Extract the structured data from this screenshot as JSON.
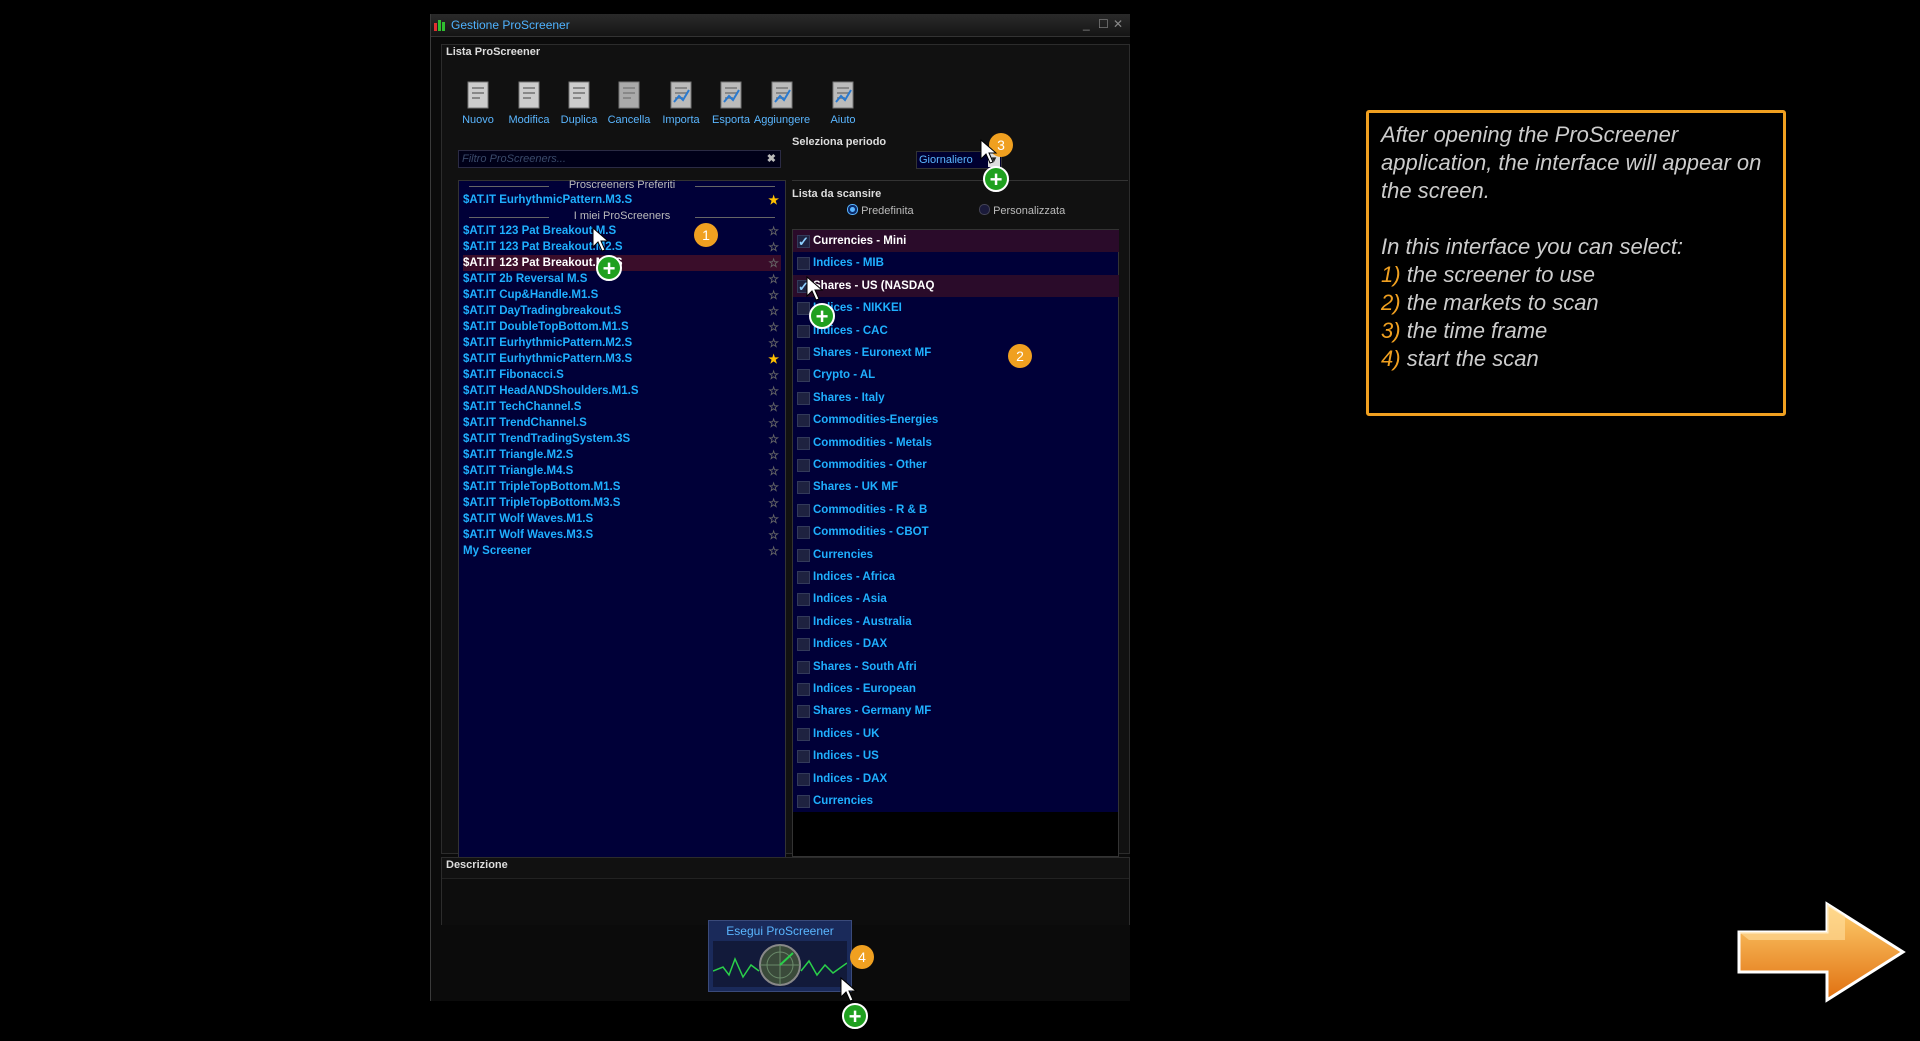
{
  "window": {
    "title": "Gestione ProScreener",
    "group_label": "Lista ProScreener"
  },
  "toolbar": [
    {
      "label": "Nuovo",
      "icon": "new-document-icon"
    },
    {
      "label": "Modifica",
      "icon": "edit-icon"
    },
    {
      "label": "Duplica",
      "icon": "duplicate-icon"
    },
    {
      "label": "Cancella",
      "icon": "trash-icon"
    },
    {
      "label": "Importa",
      "icon": "import-icon"
    },
    {
      "label": "Esporta",
      "icon": "export-icon"
    },
    {
      "label": "Aggiungere",
      "icon": "add-icon"
    },
    {
      "label": "Aiuto",
      "icon": "help-video-icon"
    }
  ],
  "filter": {
    "placeholder": "Filtro ProScreeners..."
  },
  "favorites": {
    "header": "Proscreeners Preferiti",
    "items": [
      {
        "label": "$AT.IT EurhythmicPattern.M3.S",
        "starred": true
      }
    ]
  },
  "my_screeners": {
    "header": "I miei ProScreeners",
    "items": [
      {
        "label": "$AT.IT 123 Pat Breakout.M.S",
        "starred": false
      },
      {
        "label": "$AT.IT 123 Pat Breakout.M2.S",
        "starred": false
      },
      {
        "label": "$AT.IT 123 Pat Breakout.M3.S",
        "starred": false,
        "selected": true
      },
      {
        "label": "$AT.IT 2b Reversal M.S",
        "starred": false
      },
      {
        "label": "$AT.IT Cup&Handle.M1.S",
        "starred": false
      },
      {
        "label": "$AT.IT DayTradingbreakout.S",
        "starred": false
      },
      {
        "label": "$AT.IT DoubleTopBottom.M1.S",
        "starred": false
      },
      {
        "label": "$AT.IT EurhythmicPattern.M2.S",
        "starred": false
      },
      {
        "label": "$AT.IT EurhythmicPattern.M3.S",
        "starred": true
      },
      {
        "label": "$AT.IT Fibonacci.S",
        "starred": false
      },
      {
        "label": "$AT.IT HeadANDShoulders.M1.S",
        "starred": false
      },
      {
        "label": "$AT.IT TechChannel.S",
        "starred": false
      },
      {
        "label": "$AT.IT TrendChannel.S",
        "starred": false
      },
      {
        "label": "$AT.IT TrendTradingSystem.3S",
        "starred": false
      },
      {
        "label": "$AT.IT Triangle.M2.S",
        "starred": false
      },
      {
        "label": "$AT.IT Triangle.M4.S",
        "starred": false
      },
      {
        "label": "$AT.IT TripleTopBottom.M1.S",
        "starred": false
      },
      {
        "label": "$AT.IT TripleTopBottom.M3.S",
        "starred": false
      },
      {
        "label": "$AT.IT Wolf Waves.M1.S",
        "starred": false
      },
      {
        "label": "$AT.IT Wolf Waves.M3.S",
        "starred": false
      },
      {
        "label": "My Screener",
        "starred": false
      }
    ]
  },
  "period": {
    "label": "Seleziona periodo",
    "value": "Giornaliero"
  },
  "scan_list": {
    "label": "Lista da scansire",
    "radio_default": "Predefinita",
    "radio_custom": "Personalizzata",
    "selected_radio": "Predefinita",
    "items": [
      {
        "label": "Currencies - Mini",
        "checked": true
      },
      {
        "label": "Indices - MIB",
        "checked": false
      },
      {
        "label": "Shares - US (NASDAQ",
        "checked": true
      },
      {
        "label": "Indices - NIKKEI",
        "checked": false
      },
      {
        "label": "Indices - CAC",
        "checked": false
      },
      {
        "label": "Shares - Euronext MF",
        "checked": false
      },
      {
        "label": "Crypto - AL",
        "checked": false
      },
      {
        "label": "Shares - Italy",
        "checked": false
      },
      {
        "label": "Commodities-Energies",
        "checked": false
      },
      {
        "label": "Commodities - Metals",
        "checked": false
      },
      {
        "label": "Commodities - Other",
        "checked": false
      },
      {
        "label": "Shares - UK MF",
        "checked": false
      },
      {
        "label": "Commodities - R & B",
        "checked": false
      },
      {
        "label": "Commodities - CBOT",
        "checked": false
      },
      {
        "label": "Currencies",
        "checked": false
      },
      {
        "label": "Indices - Africa",
        "checked": false
      },
      {
        "label": "Indices - Asia",
        "checked": false
      },
      {
        "label": "Indices - Australia",
        "checked": false
      },
      {
        "label": "Indices - DAX",
        "checked": false
      },
      {
        "label": "Shares - South Afri",
        "checked": false
      },
      {
        "label": "Indices - European",
        "checked": false
      },
      {
        "label": "Shares - Germany MF",
        "checked": false
      },
      {
        "label": "Indices - UK",
        "checked": false
      },
      {
        "label": "Indices - US",
        "checked": false
      },
      {
        "label": "Indices - DAX",
        "checked": false
      },
      {
        "label": "Currencies",
        "checked": false
      }
    ]
  },
  "description": {
    "label": "Descrizione"
  },
  "run_button": {
    "label": "Esegui ProScreener"
  },
  "badges": [
    "1",
    "2",
    "3",
    "4"
  ],
  "info": {
    "intro": "After opening the ProScreener application, the interface will appear on the screen.",
    "lead": "In this interface you can select:",
    "steps": [
      {
        "n": "1)",
        "text": "the screener to use"
      },
      {
        "n": "2)",
        "text": "the markets to scan"
      },
      {
        "n": "3)",
        "text": "the time frame"
      },
      {
        "n": "4)",
        "text": "start the scan"
      }
    ]
  },
  "colors": {
    "accent": "#f0a020",
    "link": "#1fb0ff",
    "list_bg": "#000038",
    "plus": "#1fa01f"
  }
}
